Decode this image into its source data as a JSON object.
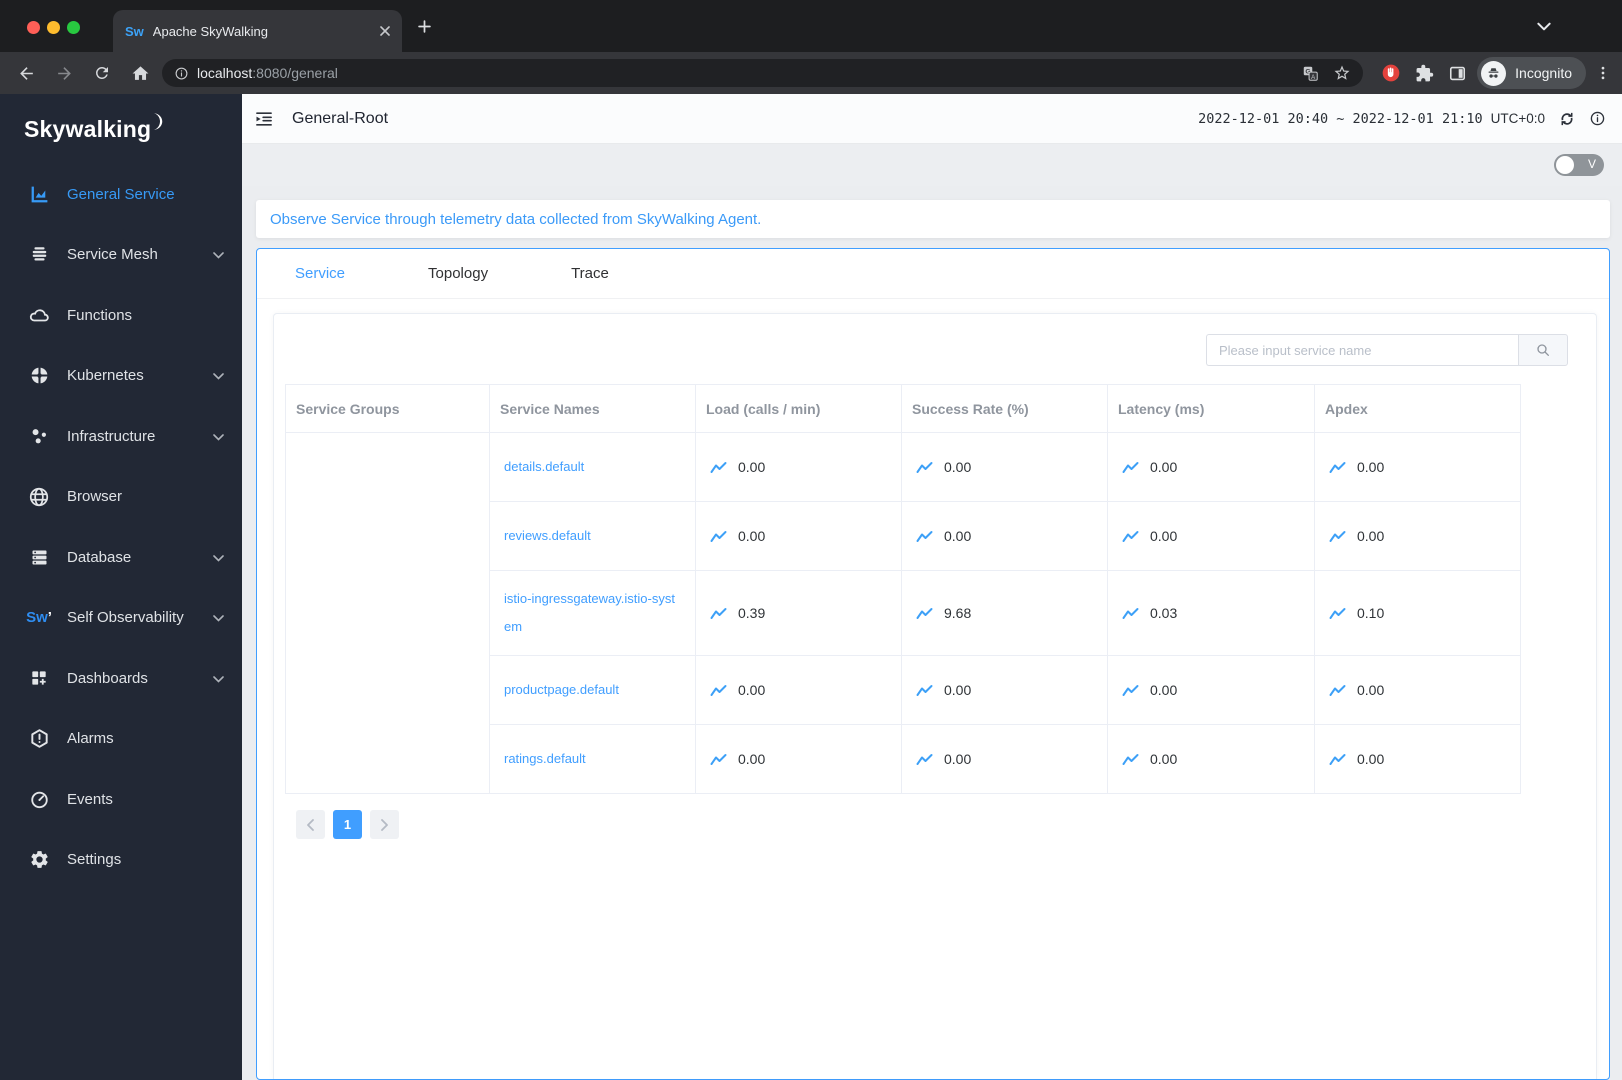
{
  "browser": {
    "tab": {
      "title": "Apache SkyWalking",
      "favicon_text": "Sw"
    },
    "url": {
      "host": "localhost",
      "rest": ":8080/general"
    },
    "incognito_label": "Incognito"
  },
  "sidebar": {
    "logo": "Skywalking",
    "sw_badge": "Sw",
    "items": [
      {
        "label": "General Service",
        "active": true,
        "expandable": false
      },
      {
        "label": "Service Mesh",
        "active": false,
        "expandable": true
      },
      {
        "label": "Functions",
        "active": false,
        "expandable": false
      },
      {
        "label": "Kubernetes",
        "active": false,
        "expandable": true
      },
      {
        "label": "Infrastructure",
        "active": false,
        "expandable": true
      },
      {
        "label": "Browser",
        "active": false,
        "expandable": false
      },
      {
        "label": "Database",
        "active": false,
        "expandable": true
      },
      {
        "label": "Self Observability",
        "active": false,
        "expandable": true
      },
      {
        "label": "Dashboards",
        "active": false,
        "expandable": true
      },
      {
        "label": "Alarms",
        "active": false,
        "expandable": false
      },
      {
        "label": "Events",
        "active": false,
        "expandable": false
      },
      {
        "label": "Settings",
        "active": false,
        "expandable": false
      }
    ]
  },
  "header": {
    "title": "General-Root",
    "time_range": "2022-12-01 20:40 ~ 2022-12-01 21:10",
    "timezone": "UTC+0:0"
  },
  "mode_toggle": {
    "label": "V"
  },
  "banner": {
    "text": "Observe Service through telemetry data collected from SkyWalking Agent."
  },
  "tabs": [
    {
      "label": "Service",
      "active": true
    },
    {
      "label": "Topology",
      "active": false
    },
    {
      "label": "Trace",
      "active": false
    }
  ],
  "search": {
    "placeholder": "Please input service name"
  },
  "table": {
    "columns": [
      "Service Groups",
      "Service Names",
      "Load (calls / min)",
      "Success Rate (%)",
      "Latency (ms)",
      "Apdex"
    ],
    "rows": [
      {
        "group": "",
        "name": "details.default",
        "load": "0.00",
        "success": "0.00",
        "latency": "0.00",
        "apdex": "0.00"
      },
      {
        "group": "",
        "name": "reviews.default",
        "load": "0.00",
        "success": "0.00",
        "latency": "0.00",
        "apdex": "0.00"
      },
      {
        "group": "",
        "name": "istio-ingressgateway.istio-system",
        "load": "0.39",
        "success": "9.68",
        "latency": "0.03",
        "apdex": "0.10"
      },
      {
        "group": "",
        "name": "productpage.default",
        "load": "0.00",
        "success": "0.00",
        "latency": "0.00",
        "apdex": "0.00"
      },
      {
        "group": "",
        "name": "ratings.default",
        "load": "0.00",
        "success": "0.00",
        "latency": "0.00",
        "apdex": "0.00"
      }
    ]
  },
  "pagination": {
    "current_page": "1"
  },
  "colors": {
    "accent": "#409eff",
    "sidebar_bg": "#222835",
    "chrome_bg": "#35363a",
    "traffic_red": "#ff5f57",
    "traffic_yellow": "#febc2e",
    "traffic_green": "#28c840",
    "banner_text": "#3b9af8",
    "blocker_red": "#e4423d"
  }
}
